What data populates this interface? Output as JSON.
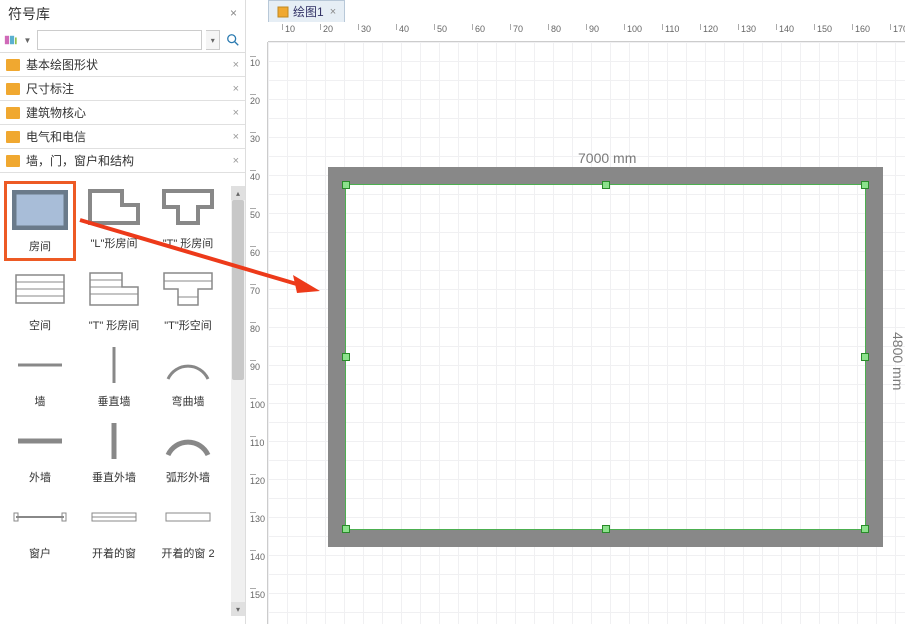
{
  "sidebar": {
    "title": "符号库",
    "search": {
      "placeholder": ""
    },
    "categories": [
      {
        "label": "基本绘图形状"
      },
      {
        "label": "尺寸标注"
      },
      {
        "label": "建筑物核心"
      },
      {
        "label": "电气和电信"
      },
      {
        "label": "墙，门，窗户和结构"
      }
    ],
    "shapes": [
      {
        "label": "房间",
        "selected": true
      },
      {
        "label": "\"L\"形房间"
      },
      {
        "label": "\"T\" 形房间"
      },
      {
        "label": "空间"
      },
      {
        "label": "\"T\" 形房间"
      },
      {
        "label": "\"T\"形空间"
      },
      {
        "label": "墙"
      },
      {
        "label": "垂直墙"
      },
      {
        "label": "弯曲墙"
      },
      {
        "label": "外墙"
      },
      {
        "label": "垂直外墙"
      },
      {
        "label": "弧形外墙"
      },
      {
        "label": "窗户"
      },
      {
        "label": "开着的窗"
      },
      {
        "label": "开着的窗 2"
      }
    ]
  },
  "tab": {
    "label": "绘图1"
  },
  "ruler_h": [
    "10",
    "20",
    "30",
    "40",
    "50",
    "60",
    "70",
    "80",
    "90",
    "100",
    "110",
    "120",
    "130",
    "140",
    "150",
    "160",
    "170"
  ],
  "ruler_v": [
    "10",
    "20",
    "30",
    "40",
    "50",
    "60",
    "70",
    "80",
    "90",
    "100",
    "110",
    "120",
    "130",
    "140",
    "150"
  ],
  "room": {
    "width_label": "7000 mm",
    "height_label": "4800 mm"
  }
}
